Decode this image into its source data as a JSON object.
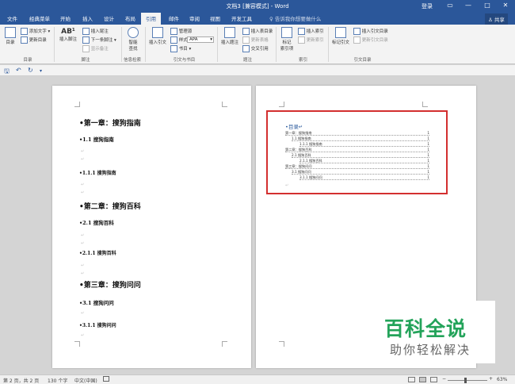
{
  "titlebar": {
    "title": "文档3 [兼容模式] - Word",
    "login": "登录",
    "win_restore": "▭",
    "win_minimize": "—",
    "win_maximize": "□",
    "win_close": "✕"
  },
  "tabs": [
    "文件",
    "经典菜单",
    "开始",
    "插入",
    "设计",
    "布局",
    "引用",
    "邮件",
    "审阅",
    "视图",
    "开发工具"
  ],
  "active_tab": "引用",
  "tellme": "♀ 告诉我你想要做什么",
  "share": "♙ 共享",
  "ribbon": {
    "toc_button": "目录",
    "add_text": "添加文字 ▾",
    "update_toc": "更新目录",
    "group_toc": "目录",
    "insert_footnote_icon_text": "AB¹",
    "insert_footnote": "插入脚注",
    "insert_endnote": "插入尾注",
    "next_footnote": "下一条脚注 ▾",
    "show_notes": "显示备注",
    "group_footnotes": "脚注",
    "smart_lookup_1": "智能",
    "smart_lookup_2": "查找",
    "group_insights": "信息检索",
    "insert_citation": "插入引文",
    "manage_sources": "管理源",
    "style_label": "样式:",
    "style_value": "APA",
    "bibliography": "书目 ▾",
    "group_citations": "引文与书目",
    "insert_caption": "插入题注",
    "insert_table_of_figures": "插入表目录",
    "update_table": "更新表格",
    "cross_reference": "交叉引用",
    "group_captions": "题注",
    "mark_entry_1": "标记",
    "mark_entry_2": "索引项",
    "insert_index": "插入索引",
    "update_index": "更新索引",
    "group_index": "索引",
    "mark_citation": "标记引文",
    "insert_toa": "插入引文目录",
    "update_toa": "更新引文目录",
    "group_toa": "引文目录"
  },
  "qat": {
    "save": "🖫",
    "undo": "↶",
    "redo": "↻",
    "customize": "▾"
  },
  "page1": {
    "ch1": "•第一章：搜狗指南",
    "s11": "•1.1 搜狗指南",
    "s111": "•1.1.1 搜狗指南",
    "ch2": "•第二章：搜狗百科",
    "s21": "•2.1 搜狗百科",
    "s211": "•2.1.1 搜狗百科",
    "ch3": "•第三章：搜狗问问",
    "s31": "•3.1 搜狗问问",
    "s311": "•3.1.1 搜狗问问",
    "para_mark": "↵"
  },
  "toc": {
    "title": "•目录↵",
    "entries": [
      {
        "text": "第一章：搜狗指南",
        "page": "1",
        "level": 1
      },
      {
        "text": "1.1 搜狗指南",
        "page": "1",
        "level": 2
      },
      {
        "text": "1.1.1 搜狗指南",
        "page": "1",
        "level": 3
      },
      {
        "text": "第二章：搜狗百科",
        "page": "1",
        "level": 1
      },
      {
        "text": "2.1 搜狗百科",
        "page": "1",
        "level": 2
      },
      {
        "text": "2.1.1 搜狗百科",
        "page": "1",
        "level": 3
      },
      {
        "text": "第三章：搜狗问问",
        "page": "1",
        "level": 1
      },
      {
        "text": "3.1 搜狗问问",
        "page": "1",
        "level": 2
      },
      {
        "text": "3.1.1 搜狗问问",
        "page": "1",
        "level": 3
      }
    ],
    "end_mark": "↵"
  },
  "watermark": {
    "line1": "百科全说",
    "line2": "助你轻松解决"
  },
  "status": {
    "page": "第 2 页，共 2 页",
    "words": "130 个字",
    "language": "中文(中国)",
    "zoom_minus": "−",
    "zoom_plus": "+",
    "zoom": "63%"
  },
  "colors": {
    "accent": "#2b579a",
    "toc_border": "#d32f2f",
    "watermark_green": "#23a35a"
  }
}
